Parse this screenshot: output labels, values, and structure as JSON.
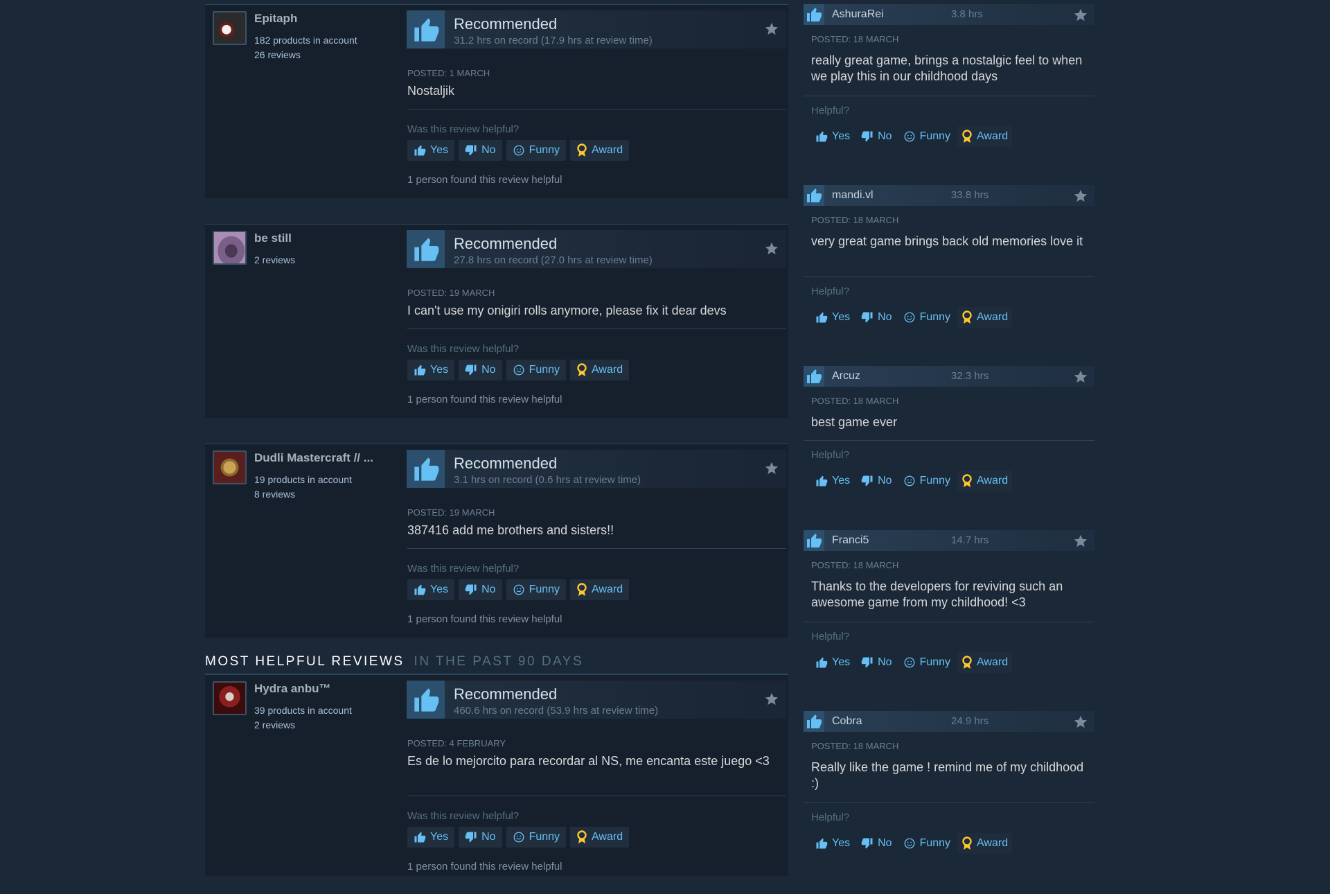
{
  "vote_labels": {
    "recommended": "Recommended",
    "helpful_question": "Was this review helpful?",
    "helpful_short": "Helpful?",
    "yes": "Yes",
    "no": "No",
    "funny": "Funny",
    "award": "Award"
  },
  "colors": {
    "accent_blue": "#66c0f4",
    "award_gold": "#ffc82c",
    "page_bg": "#1b2838"
  },
  "section": {
    "title": "MOST HELPFUL REVIEWS",
    "subtitle": "IN THE PAST 90 DAYS"
  },
  "reviews": [
    {
      "author": "Epitaph",
      "stat1": "182 products in account",
      "stat2": "26 reviews",
      "avatar_icon": "sneakers-avatar-icon",
      "hours": "31.2 hrs on record (17.9 hrs at review time)",
      "posted": "POSTED: 1 MARCH",
      "text": "Nostaljik",
      "found": "1 person found this review helpful"
    },
    {
      "author": "be still",
      "stat1": "2 reviews",
      "stat2": "",
      "avatar_icon": "figure-avatar-icon",
      "hours": "27.8 hrs on record (27.0 hrs at review time)",
      "posted": "POSTED: 19 MARCH",
      "text": "I can't use my onigiri rolls anymore, please fix it dear devs",
      "found": "1 person found this review helpful"
    },
    {
      "author": "Dudli Mastercraft // ...",
      "stat1": "19 products in account",
      "stat2": "8 reviews",
      "avatar_icon": "coin-avatar-icon",
      "hours": "3.1 hrs on record (0.6 hrs at review time)",
      "posted": "POSTED: 19 MARCH",
      "text": "387416 add me brothers and sisters!!",
      "found": "1 person found this review helpful"
    },
    {
      "author": "Hydra anbu™",
      "stat1": "39 products in account",
      "stat2": "2 reviews",
      "avatar_icon": "demon-avatar-icon",
      "hours": "460.6 hrs on record (53.9 hrs at review time)",
      "posted": "POSTED: 4 FEBRUARY",
      "text": "Es de lo mejorcito para recordar al NS, me encanta este juego <3",
      "found": "1 person found this review helpful"
    }
  ],
  "recent_reviews": [
    {
      "author": "AshuraRei",
      "hours": "3.8 hrs",
      "posted": "POSTED: 18 MARCH",
      "text": "really great game, brings a nostalgic feel to when we play this in our childhood days"
    },
    {
      "author": "mandi.vl",
      "hours": "33.8 hrs",
      "posted": "POSTED: 18 MARCH",
      "text": "very great game brings back old memories love it"
    },
    {
      "author": "Arcuz",
      "hours": "32.3 hrs",
      "posted": "POSTED: 18 MARCH",
      "text": "best game ever"
    },
    {
      "author": "Franci5",
      "hours": "14.7 hrs",
      "posted": "POSTED: 18 MARCH",
      "text": "Thanks to the developers for reviving such an awesome game from my childhood! <3"
    },
    {
      "author": "Cobra",
      "hours": "24.9 hrs",
      "posted": "POSTED: 18 MARCH",
      "text": "Really like the game ! remind me of my childhood :)"
    }
  ]
}
